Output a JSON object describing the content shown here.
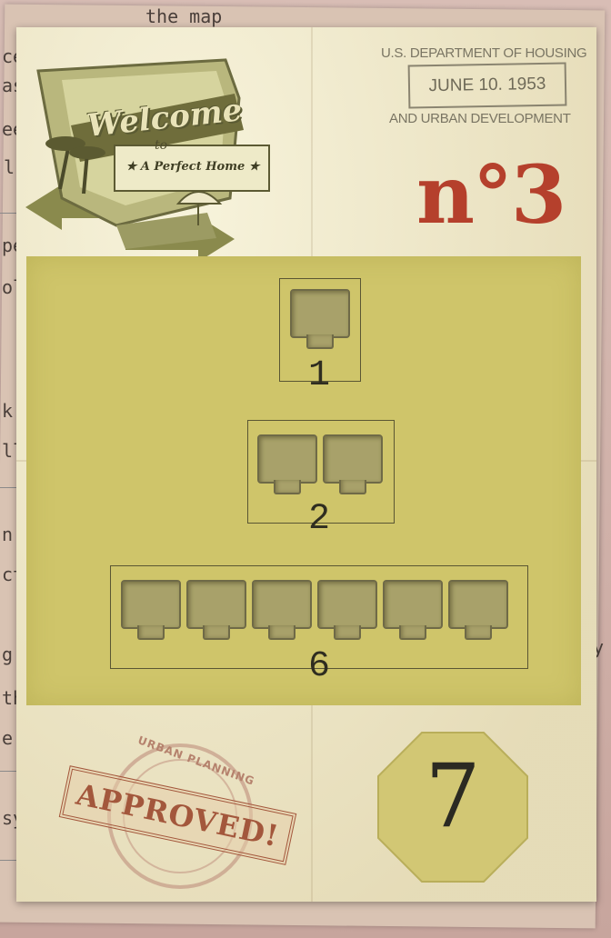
{
  "background": {
    "lines": [
      "ce",
      "as",
      "ee",
      "l",
      "pe",
      "ol",
      "k",
      "ll",
      "n",
      "ct",
      "g",
      "th",
      "e",
      "sy",
      "y",
      "the map"
    ]
  },
  "card": {
    "sign": {
      "title": "Welcome",
      "to": "to",
      "subtitle": "★ A Perfect Home ★"
    },
    "department": {
      "top": "U.S. DEPARTMENT OF HOUSING",
      "date": "JUNE 10. 1953",
      "bottom": "AND URBAN DEVELOPMENT"
    },
    "number": "n°3",
    "groups": [
      {
        "label": "1",
        "slots": 1
      },
      {
        "label": "2",
        "slots": 2
      },
      {
        "label": "6",
        "slots": 6
      }
    ],
    "stamp": {
      "ring": "URBAN PLANNING",
      "text": "APPROVED!"
    },
    "value": "7",
    "colors": {
      "accent": "#b5402c",
      "grid": "#cfc56a",
      "paper": "#efe7c6"
    }
  }
}
